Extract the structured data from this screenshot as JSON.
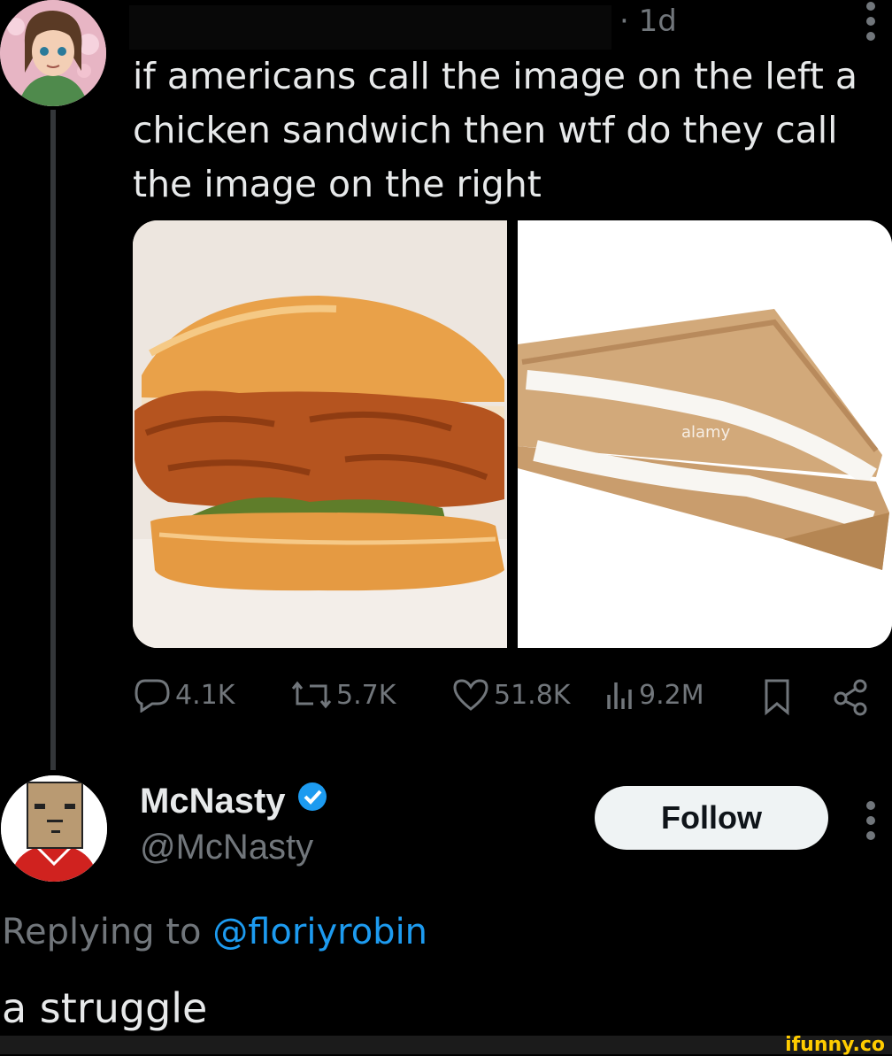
{
  "tweet": {
    "timestamp": "· 1d",
    "text": "if americans call the image on the left a chicken sandwich then wtf do they call the image on the right",
    "stats": {
      "replies": "4.1K",
      "retweets": "5.7K",
      "likes": "51.8K",
      "views": "9.2M"
    },
    "icons": [
      "reply-icon",
      "retweet-icon",
      "like-icon",
      "views-icon",
      "bookmark-icon",
      "share-icon"
    ]
  },
  "reply": {
    "display_name": "McNasty",
    "handle": "@McNasty",
    "follow_label": "Follow",
    "replying_prefix": "Replying to ",
    "replying_handle": "@floriyrobin",
    "text": "a struggle"
  },
  "watermark": "ifunny.co",
  "colors": {
    "background": "#000000",
    "text": "#e7e9ea",
    "muted": "#71767b",
    "accent": "#1d9bf0",
    "follow_bg": "#eff3f4",
    "watermark": "#ffcc00"
  }
}
